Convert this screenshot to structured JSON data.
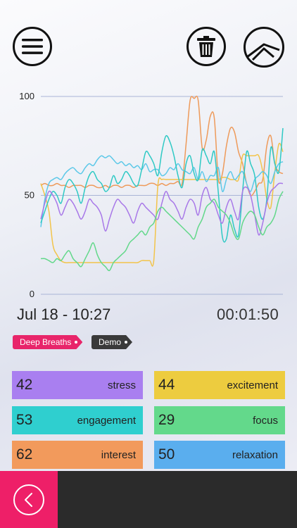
{
  "header": {
    "menu_icon": "hamburger-menu-icon",
    "delete_icon": "trash-icon",
    "chart_type_icon": "line-chart-icon"
  },
  "chart_data": {
    "type": "line",
    "y_ticks": [
      "100",
      "50",
      "0"
    ],
    "ylim": [
      0,
      100
    ],
    "grid": true,
    "legend": "none",
    "x": [
      0,
      1,
      2,
      3,
      4,
      5,
      6,
      7,
      8,
      9,
      10,
      11,
      12,
      13,
      14,
      15,
      16,
      17,
      18,
      19,
      20,
      21,
      22,
      23,
      24,
      25,
      26,
      27,
      28,
      29,
      30,
      31,
      32,
      33,
      34,
      35,
      36,
      37,
      38,
      39,
      40,
      41,
      42,
      43,
      44,
      45,
      46,
      47,
      48,
      49,
      50,
      51,
      52,
      53,
      54,
      55,
      56,
      57,
      58,
      59,
      60
    ],
    "series": [
      {
        "color": "#ee9a5a",
        "values": [
          55,
          56,
          55,
          55,
          56,
          55,
          55,
          54,
          55,
          55,
          55,
          54,
          55,
          55,
          54,
          54,
          55,
          54,
          55,
          55,
          54,
          55,
          55,
          54,
          55,
          55,
          55,
          56,
          56,
          55,
          56,
          55,
          56,
          56,
          57,
          56,
          76,
          98,
          99,
          98,
          74,
          78,
          90,
          89,
          58,
          61,
          75,
          84,
          82,
          72,
          66,
          56,
          50,
          52,
          56,
          58,
          75,
          80,
          66,
          62,
          61
        ]
      },
      {
        "color": "#f2c44a",
        "values": [
          56,
          50,
          42,
          25,
          20,
          17,
          16,
          16,
          16,
          16,
          16,
          16,
          16,
          16,
          16,
          16,
          16,
          16,
          16,
          16,
          16,
          16,
          16,
          16,
          16,
          17,
          17,
          17,
          17,
          55,
          58,
          58,
          58,
          58,
          58,
          58,
          58,
          58,
          58,
          58,
          58,
          58,
          58,
          58,
          58,
          59,
          59,
          58,
          58,
          58,
          70,
          70,
          70,
          70,
          70,
          62,
          48,
          44,
          62,
          76,
          72
        ]
      },
      {
        "color": "#5bc8e8",
        "values": [
          34,
          48,
          56,
          58,
          59,
          58,
          61,
          63,
          64,
          62,
          61,
          64,
          66,
          65,
          68,
          70,
          69,
          70,
          68,
          66,
          67,
          65,
          66,
          64,
          65,
          63,
          66,
          62,
          63,
          63,
          60,
          61,
          64,
          63,
          66,
          63,
          62,
          61,
          64,
          58,
          62,
          57,
          60,
          60,
          64,
          52,
          58,
          62,
          58,
          60,
          62,
          56,
          52,
          58,
          60,
          62,
          60,
          56,
          62,
          66,
          67
        ]
      },
      {
        "color": "#2ec9c4",
        "values": [
          36,
          42,
          48,
          52,
          50,
          46,
          54,
          58,
          56,
          52,
          46,
          54,
          60,
          62,
          58,
          56,
          52,
          54,
          60,
          56,
          58,
          62,
          60,
          56,
          55,
          63,
          72,
          70,
          66,
          60,
          72,
          80,
          77,
          70,
          60,
          54,
          66,
          70,
          61,
          58,
          73,
          70,
          66,
          72,
          51,
          29,
          28,
          40,
          33,
          30,
          52,
          72,
          66,
          60,
          44,
          38,
          48,
          74,
          66,
          62,
          84
        ]
      },
      {
        "color": "#a878e8",
        "values": [
          38,
          46,
          52,
          50,
          46,
          40,
          44,
          48,
          46,
          42,
          38,
          42,
          48,
          46,
          44,
          40,
          32,
          38,
          44,
          48,
          46,
          44,
          40,
          36,
          42,
          46,
          44,
          42,
          40,
          38,
          46,
          52,
          48,
          46,
          42,
          38,
          44,
          48,
          46,
          40,
          50,
          54,
          48,
          46,
          40,
          36,
          44,
          48,
          42,
          38,
          52,
          54,
          50,
          40,
          30,
          36,
          46,
          52,
          54,
          56,
          56
        ]
      },
      {
        "color": "#62d88a",
        "values": [
          18,
          18,
          17,
          16,
          18,
          17,
          20,
          22,
          18,
          16,
          14,
          18,
          22,
          26,
          20,
          16,
          14,
          12,
          16,
          18,
          20,
          22,
          26,
          28,
          30,
          32,
          30,
          34,
          36,
          42,
          44,
          42,
          40,
          38,
          36,
          34,
          32,
          30,
          28,
          34,
          38,
          44,
          46,
          48,
          44,
          42,
          40,
          36,
          30,
          28,
          36,
          40,
          42,
          40,
          34,
          30,
          34,
          36,
          40,
          48,
          52
        ]
      }
    ]
  },
  "session": {
    "date": "Jul 18 - 10:27",
    "duration": "00:01:50"
  },
  "tags": [
    {
      "label": "Deep Breaths",
      "color": "#e8256a"
    },
    {
      "label": "Demo",
      "color": "#3a3a3a"
    }
  ],
  "metrics": [
    {
      "value": "42",
      "label": "stress",
      "color": "#a97ff0"
    },
    {
      "value": "44",
      "label": "excitement",
      "color": "#edcc3f"
    },
    {
      "value": "53",
      "label": "engagement",
      "color": "#2fcfcf"
    },
    {
      "value": "29",
      "label": "focus",
      "color": "#63d98b"
    },
    {
      "value": "62",
      "label": "interest",
      "color": "#f29a5c"
    },
    {
      "value": "50",
      "label": "relaxation",
      "color": "#5aaeee"
    }
  ],
  "footer": {
    "back_icon": "chevron-left-icon",
    "back_color": "#ee1f68",
    "bar_color": "#2b2b2b"
  }
}
